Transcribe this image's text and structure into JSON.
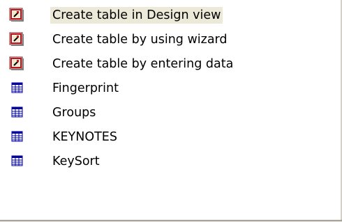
{
  "items": [
    {
      "label": "Create table in Design view",
      "icon": "shortcut-wand-icon",
      "selected": true
    },
    {
      "label": "Create table by using wizard",
      "icon": "shortcut-wand-icon",
      "selected": false
    },
    {
      "label": "Create table by entering data",
      "icon": "shortcut-wand-icon",
      "selected": false
    },
    {
      "label": "Fingerprint",
      "icon": "table-icon",
      "selected": false
    },
    {
      "label": "Groups",
      "icon": "table-icon",
      "selected": false
    },
    {
      "label": "KEYNOTES",
      "icon": "table-icon",
      "selected": false
    },
    {
      "label": "KeySort",
      "icon": "table-icon",
      "selected": false
    }
  ],
  "colors": {
    "selection_bg": "#ece9d8",
    "shortcut_icon_red": "#c0161b",
    "table_icon_blue": "#00009c"
  }
}
